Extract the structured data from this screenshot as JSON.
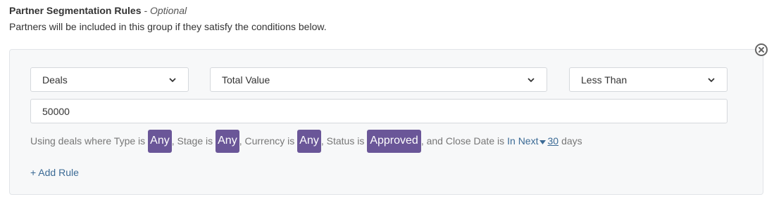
{
  "header": {
    "title": "Partner Segmentation Rules",
    "title_suffix": "- Optional",
    "subtitle": "Partners will be included in this group if they satisfy the conditions below."
  },
  "rule": {
    "object_select": "Deals",
    "field_select": "Total Value",
    "operator_select": "Less Than",
    "value": "50000",
    "sentence": {
      "prefix": "Using deals where Type is",
      "type_value": "Any",
      "stage_label": ", Stage is",
      "stage_value": "Any",
      "currency_label": ", Currency is",
      "currency_value": "Any",
      "status_label": ", Status is",
      "status_value": "Approved",
      "close_label": ", and Close Date is",
      "close_mode": "In Next",
      "close_amount": "30",
      "close_unit": "days"
    }
  },
  "add_rule_label": "+ Add Rule",
  "colors": {
    "pill": "#6a5698",
    "link": "#3b6a95",
    "panel_bg": "#f7f8f9"
  },
  "icons": {
    "remove": "close-circle-icon",
    "dropdown": "chevron-down-icon",
    "close_mode": "caret-down-icon"
  }
}
